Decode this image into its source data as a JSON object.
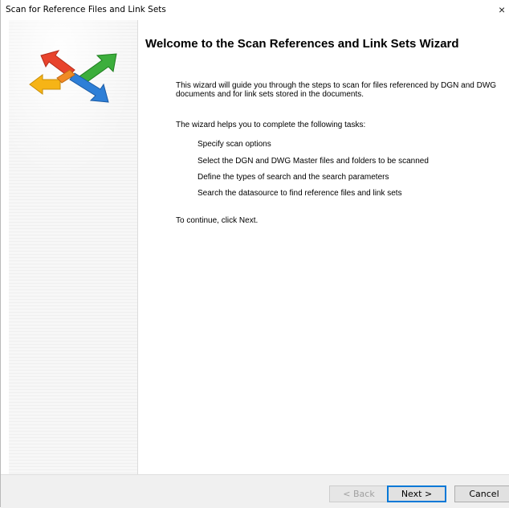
{
  "window": {
    "title": "Scan for Reference Files and Link Sets",
    "close_glyph": "×"
  },
  "sidebar": {
    "logo_icon": "arrows-logo-icon",
    "logo_colors": [
      "#e8432c",
      "#f6b416",
      "#3cae3c",
      "#2e7fd7"
    ]
  },
  "content": {
    "heading": "Welcome to the Scan References and Link Sets Wizard",
    "intro": "This wizard will guide you through the steps to scan for files referenced by DGN and DWG documents and for link sets stored in the documents.",
    "tasks_intro": "The wizard helps you to complete the following tasks:",
    "tasks": [
      "Specify scan options",
      "Select the DGN and DWG Master files and folders to be scanned",
      "Define the types of search and the search parameters",
      "Search the datasource to find reference files and link sets"
    ],
    "continue_text": "To continue, click Next."
  },
  "buttons": {
    "back": "< Back",
    "next": "Next >",
    "cancel": "Cancel"
  }
}
